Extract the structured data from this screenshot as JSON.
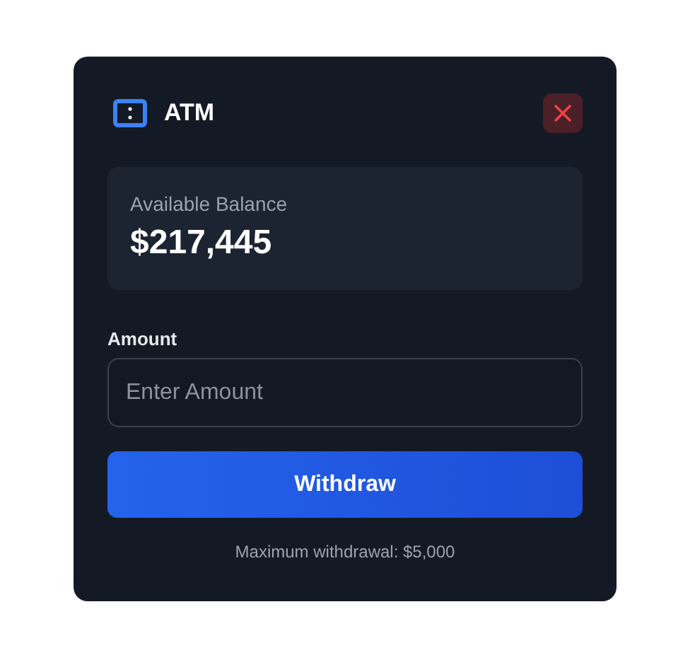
{
  "window": {
    "title": "ATM"
  },
  "balance": {
    "label": "Available Balance",
    "amount": "$217,445"
  },
  "amount_field": {
    "label": "Amount",
    "placeholder": "Enter Amount"
  },
  "buttons": [
    "Withdraw"
  ],
  "note": "Maximum withdrawal: $5,000"
}
